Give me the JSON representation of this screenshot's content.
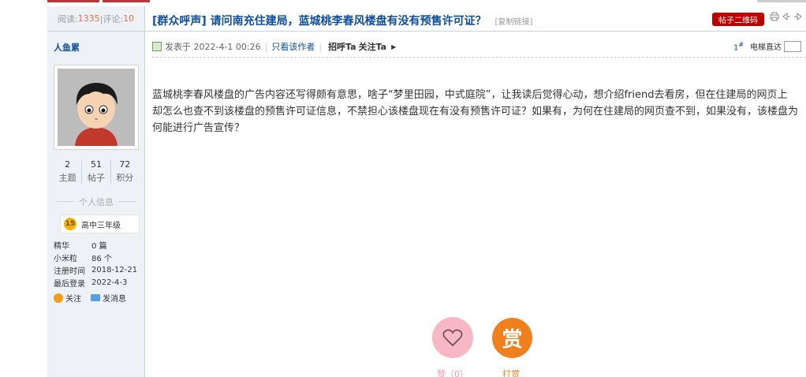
{
  "header": {
    "views_label": "阅读:",
    "views_count": "1335",
    "replies_label": "|评论:",
    "replies_count": "10",
    "title": "[群众呼声] 请问南充住建局，蓝城桃李春风楼盘有没有预售许可证？",
    "copy_link": "[复制链接]",
    "qr_button": "帖子二维码",
    "print_icon": "print-icon",
    "prev_icon": "prev-thread-icon",
    "next_icon": "next-thread-icon"
  },
  "author": {
    "name": "人鱼累",
    "stats": [
      {
        "value": "2",
        "label": "主题"
      },
      {
        "value": "51",
        "label": "帖子"
      },
      {
        "value": "72",
        "label": "积分"
      }
    ],
    "info_title": "个人信息",
    "level_num": "15",
    "level_name": "高中三年级",
    "info": [
      {
        "k": "精华",
        "v": "0 篇"
      },
      {
        "k": "小米粒",
        "v": "86 个"
      },
      {
        "k": "注册时间",
        "v": "2018-12-21"
      },
      {
        "k": "最后登录",
        "v": "2022-4-3"
      }
    ],
    "follow": "关注",
    "message": "发消息"
  },
  "post": {
    "posted": "发表于 2022-4-1 00:26",
    "only_author": "只看该作者",
    "greet": "招呼Ta",
    "follow_ta": "关注Ta",
    "floor_num": "1",
    "floor_sign": "#",
    "elevator": "电梯直达",
    "content_line1": "蓝城桃李春风楼盘的广告内容还写得颇有意思，啥子“梦里田园，中式庭院”，让我读后觉得心动，想介绍friend去看房，但在住建局的网页上",
    "content_line2": "却怎么也查不到该楼盘的预售许可证信息，不禁担心该楼盘现在有没有预售许可证？如果有，为何在住建局的网页查不到，如果没有，该楼盘为",
    "content_line3": "何能进行广告宣传？"
  },
  "buttons": {
    "like_label": "赞（0）",
    "reward_glyph": "赏",
    "reward_label": "打赏"
  },
  "colors": {
    "accent_blue": "#0d4d9b",
    "sidebar_bg": "#eef2f7",
    "like_pink": "#f7b7c5",
    "reward_orange": "#f07f1e"
  }
}
